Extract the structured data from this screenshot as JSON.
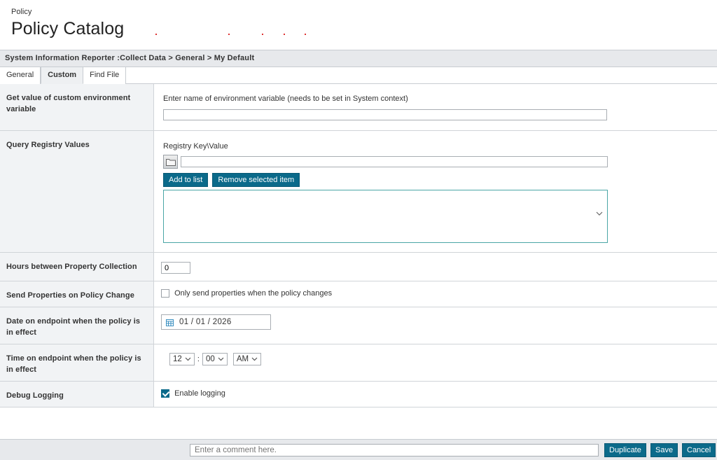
{
  "header": {
    "crumb": "Policy",
    "title": "Policy Catalog"
  },
  "path": "System Information Reporter :Collect Data > General > My Default",
  "tabs": [
    {
      "label": "General",
      "active": false
    },
    {
      "label": "Custom",
      "active": true
    },
    {
      "label": "Find File",
      "active": false
    }
  ],
  "rows": {
    "env": {
      "label": "Get value of custom environment variable",
      "hint": "Enter name of environment variable (needs to be set in System context)",
      "value": ""
    },
    "registry": {
      "label": "Query Registry Values",
      "hint": "Registry Key\\Value",
      "value": "",
      "add_label": "Add to list",
      "remove_label": "Remove selected item"
    },
    "hours": {
      "label": "Hours between Property Collection",
      "value": "0"
    },
    "send": {
      "label": "Send Properties on Policy Change",
      "checkbox_label": "Only send properties when the policy changes",
      "checked": false
    },
    "date": {
      "label": "Date on endpoint when the policy is in effect",
      "value": "01 / 01 / 2026"
    },
    "time": {
      "label": "Time on endpoint when the policy is in effect",
      "hour": "12",
      "minute": "00",
      "ampm": "AM",
      "separator": ":"
    },
    "debug": {
      "label": "Debug Logging",
      "checkbox_label": "Enable logging",
      "checked": true
    }
  },
  "footer": {
    "comment_placeholder": "Enter a comment here.",
    "duplicate_label": "Duplicate",
    "save_label": "Save",
    "cancel_label": "Cancel"
  },
  "colors": {
    "accent": "#0b6a8a",
    "label_bg": "#f1f3f5",
    "bar_bg": "#e7e9ec"
  },
  "icons": {
    "folder": "folder-icon",
    "calendar": "calendar-icon",
    "chevron": "chevron-down-icon",
    "check": "checkmark-icon"
  }
}
